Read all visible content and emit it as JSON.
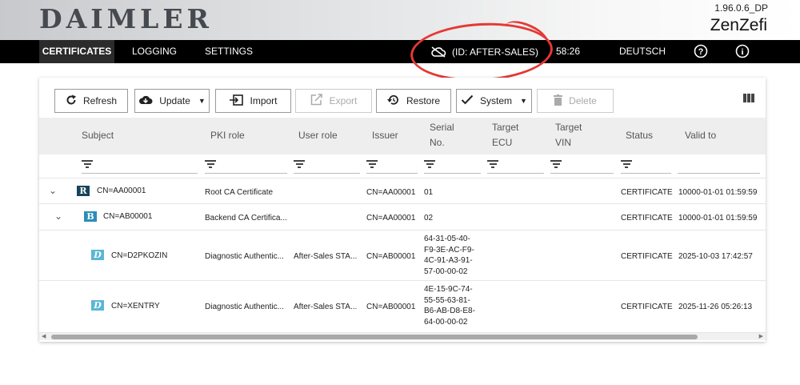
{
  "header": {
    "logo": "DAIMLER",
    "version": "1.96.0.6_DP",
    "app_name": "ZenZefi"
  },
  "nav": {
    "certificates": "CERTIFICATES",
    "logging": "LOGGING",
    "settings": "SETTINGS",
    "environment": "(ID: AFTER-SALES)",
    "timer": "58:26",
    "language": "DEUTSCH",
    "help_icon": "help-circle-icon",
    "info_icon": "info-circle-icon",
    "cloud_icon": "cloud-off-icon"
  },
  "toolbar": {
    "refresh": "Refresh",
    "update": "Update",
    "import": "Import",
    "export": "Export",
    "restore": "Restore",
    "system": "System",
    "delete": "Delete"
  },
  "table": {
    "columns": {
      "subject": "Subject",
      "pki_role": "PKI role",
      "user_role": "User role",
      "issuer": "Issuer",
      "serial_1": "Serial",
      "serial_2": "No.",
      "target_ecu_1": "Target",
      "target_ecu_2": "ECU",
      "target_vin_1": "Target",
      "target_vin_2": "VIN",
      "status": "Status",
      "valid_to": "Valid to"
    },
    "rows": [
      {
        "icon_letter": "R",
        "subject": "CN=AA00001",
        "pki_role": "Root CA Certificate",
        "user_role": "",
        "issuer": "CN=AA00001",
        "serial": [
          "01"
        ],
        "status": "CERTIFICATE",
        "valid_to": "10000-01-01 01:59:59"
      },
      {
        "icon_letter": "B",
        "subject": "CN=AB00001",
        "pki_role": "Backend CA Certifica...",
        "user_role": "",
        "issuer": "CN=AA00001",
        "serial": [
          "02"
        ],
        "status": "CERTIFICATE",
        "valid_to": "10000-01-01 01:59:59"
      },
      {
        "icon_letter": "D",
        "subject": "CN=D2PKOZIN",
        "pki_role": "Diagnostic Authentic...",
        "user_role": "After-Sales STA...",
        "issuer": "CN=AB00001",
        "serial": [
          "64-31-05-40-",
          "F9-3E-AC-F9-",
          "4C-91-A3-91-",
          "57-00-00-02"
        ],
        "status": "CERTIFICATE",
        "valid_to": "2025-10-03 17:42:57"
      },
      {
        "icon_letter": "D",
        "subject": "CN=XENTRY",
        "pki_role": "Diagnostic Authentic...",
        "user_role": "After-Sales STA...",
        "issuer": "CN=AB00001",
        "serial": [
          "4E-15-9C-74-",
          "55-55-63-81-",
          "B6-AB-D8-E8-",
          "64-00-00-02"
        ],
        "status": "CERTIFICATE",
        "valid_to": "2025-11-26 05:26:13"
      }
    ]
  }
}
